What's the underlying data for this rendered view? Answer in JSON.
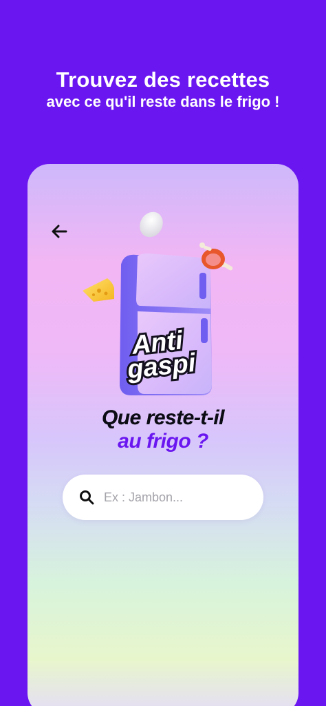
{
  "headline": {
    "line1": "Trouvez des recettes",
    "line2": "avec ce qu'il reste dans le frigo !"
  },
  "screen": {
    "back_icon": "arrow-left-icon",
    "logo": {
      "line1": "Anti",
      "line2": "gaspi"
    },
    "title": {
      "line1": "Que reste-t-il",
      "line2": "au frigo ?"
    },
    "search": {
      "icon": "search-icon",
      "placeholder": "Ex : Jambon..."
    }
  },
  "colors": {
    "brand_purple": "#6A16F0",
    "title_dark": "#0c0c14"
  }
}
